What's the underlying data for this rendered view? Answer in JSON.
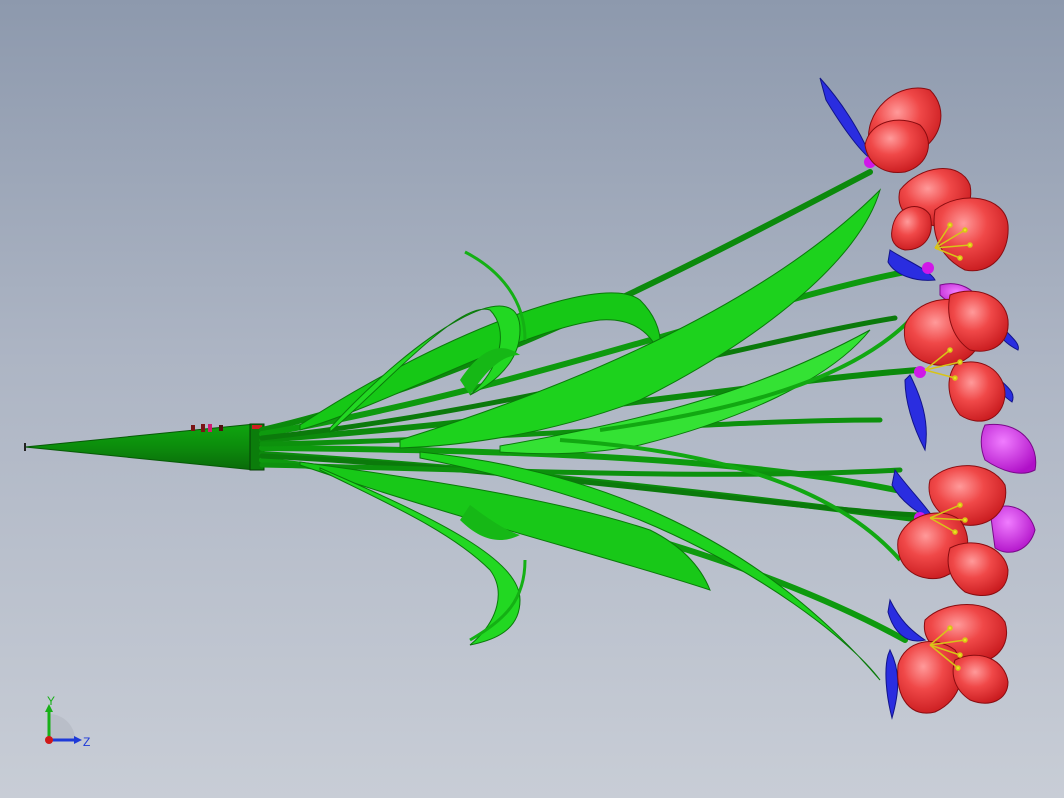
{
  "viewport": {
    "background_top": "#8d99ad",
    "background_bottom": "#c8cdd6"
  },
  "model": {
    "stem_color": "#0a9a0a",
    "stem_dark_color": "#0c7a0c",
    "leaf_color": "#18d018",
    "petal_color": "#ee2f33",
    "petal_highlight_color": "#ff8a8a",
    "sepal_color": "#2a2de0",
    "accent_petal_color": "#d018e8",
    "stamen_color": "#f0e020",
    "flower_count": 6
  },
  "triad": {
    "y_label": "Y",
    "z_label": "Z",
    "y_axis_color": "#18b018",
    "z_axis_color": "#1e3ad8",
    "origin_color": "#d01818"
  }
}
